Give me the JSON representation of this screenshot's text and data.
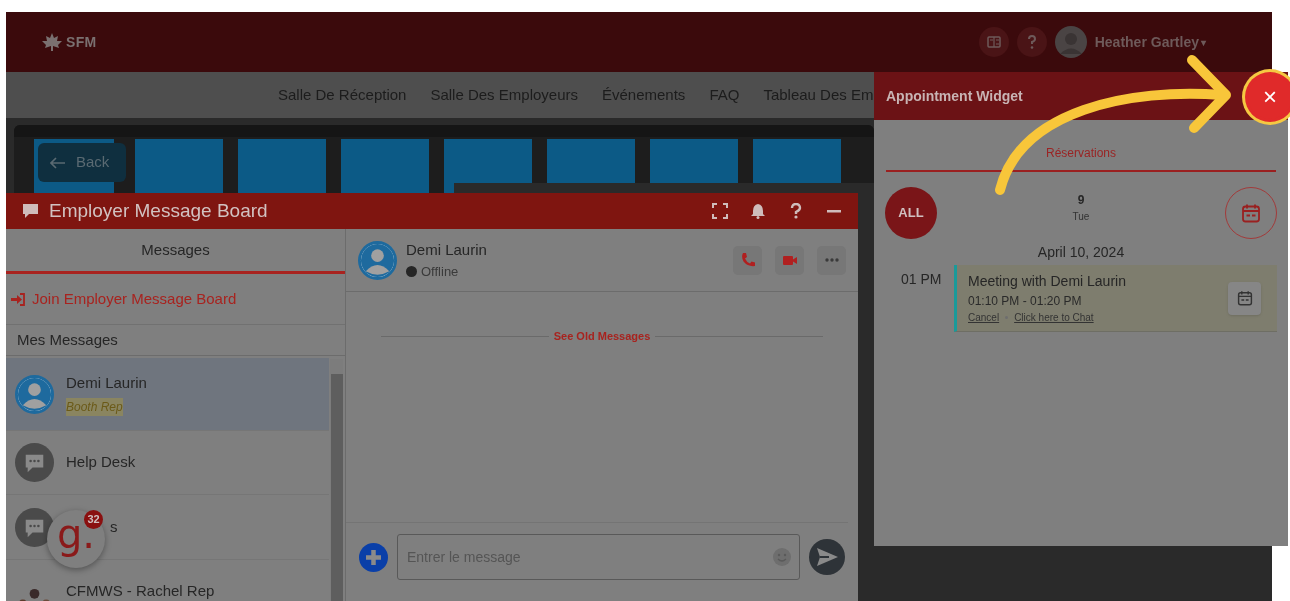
{
  "header": {
    "logo": "SFM",
    "user": "Heather Gartley",
    "caret": "▾"
  },
  "nav": [
    "Salle De Réception",
    "Salle Des Employeurs",
    "Événements",
    "FAQ",
    "Tableau Des Em"
  ],
  "back_button": "Back",
  "message_board": {
    "title": "Employer Message Board",
    "tab": {
      "label": "Messages",
      "selected": true
    },
    "join_link": "Join Employer Message Board",
    "section": "Mes Messages",
    "conversations": [
      {
        "name": "Demi Laurin",
        "role": "Booth Rep",
        "kind": "person",
        "selected": true
      },
      {
        "name": "Help Desk",
        "kind": "chat",
        "selected": false
      },
      {
        "name": "s",
        "kind": "chat_hidden",
        "selected": false
      },
      {
        "name": "CFMWS - Rachel Rep",
        "kind": "group",
        "selected": false
      }
    ],
    "chat": {
      "contact": "Demi Laurin",
      "status": "Offline",
      "online": false,
      "old_messages": "See Old Messages",
      "input_placeholder": "Entrer le message"
    }
  },
  "chat_badge": {
    "letter": "g.",
    "count": "32"
  },
  "appointment_widget": {
    "title": "Appointment Widget",
    "close": "×",
    "tab": {
      "label": "Réservations",
      "selected": true
    },
    "all_button": "ALL",
    "day": "9",
    "weekday": "Tue",
    "date": "April 10, 2024",
    "slots": [
      {
        "time": "01 PM",
        "appointments": [
          {
            "title": "Meeting with Demi Laurin",
            "time": "01:10 PM - 01:20 PM",
            "links": [
              "Cancel",
              "Click here to Chat"
            ]
          }
        ]
      }
    ]
  }
}
